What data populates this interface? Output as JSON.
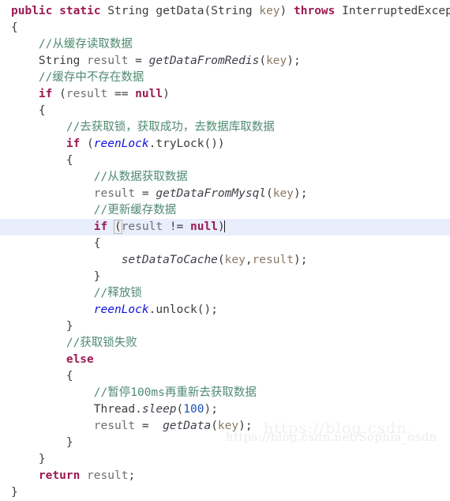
{
  "editor": {
    "language": "java",
    "background_color": "#ffffff",
    "current_line_highlight_color": "#e8eefc",
    "current_line_index": 12,
    "colors": {
      "keyword": "#9b1b52",
      "comment": "#4f8a72",
      "field": "#1010dd",
      "method": "#3f3f4a",
      "parameter": "#8a7a63",
      "number": "#1550b5",
      "text": "#3c3c3c"
    },
    "lines": [
      {
        "indent": 0,
        "tokens": [
          {
            "t": "public",
            "c": "kw"
          },
          {
            "t": " ",
            "c": "plain"
          },
          {
            "t": "static",
            "c": "kw"
          },
          {
            "t": " ",
            "c": "plain"
          },
          {
            "t": "String",
            "c": "type"
          },
          {
            "t": " ",
            "c": "plain"
          },
          {
            "t": "getData",
            "c": "plain"
          },
          {
            "t": "(",
            "c": "punct"
          },
          {
            "t": "String",
            "c": "type"
          },
          {
            "t": " ",
            "c": "plain"
          },
          {
            "t": "key",
            "c": "ident"
          },
          {
            "t": ") ",
            "c": "punct"
          },
          {
            "t": "throws",
            "c": "kw"
          },
          {
            "t": " ",
            "c": "plain"
          },
          {
            "t": "InterruptedException",
            "c": "type"
          }
        ]
      },
      {
        "indent": 0,
        "tokens": [
          {
            "t": "{",
            "c": "punct"
          }
        ]
      },
      {
        "indent": 1,
        "tokens": [
          {
            "t": "//从缓存读取数据",
            "c": "comment"
          }
        ]
      },
      {
        "indent": 1,
        "tokens": [
          {
            "t": "String",
            "c": "type"
          },
          {
            "t": " ",
            "c": "plain"
          },
          {
            "t": "result",
            "c": "local"
          },
          {
            "t": " = ",
            "c": "punct"
          },
          {
            "t": "getDataFromRedis",
            "c": "method"
          },
          {
            "t": "(",
            "c": "punct"
          },
          {
            "t": "key",
            "c": "ident"
          },
          {
            "t": ");",
            "c": "punct"
          }
        ]
      },
      {
        "indent": 1,
        "tokens": [
          {
            "t": "//缓存中不存在数据",
            "c": "comment"
          }
        ]
      },
      {
        "indent": 1,
        "tokens": [
          {
            "t": "if",
            "c": "kw"
          },
          {
            "t": " (",
            "c": "punct"
          },
          {
            "t": "result",
            "c": "local"
          },
          {
            "t": " == ",
            "c": "punct"
          },
          {
            "t": "null",
            "c": "kw"
          },
          {
            "t": ")",
            "c": "punct"
          }
        ]
      },
      {
        "indent": 1,
        "tokens": [
          {
            "t": "{",
            "c": "punct"
          }
        ]
      },
      {
        "indent": 2,
        "tokens": [
          {
            "t": "//去获取锁，获取成功，去数据库取数据",
            "c": "comment"
          }
        ]
      },
      {
        "indent": 2,
        "tokens": [
          {
            "t": "if",
            "c": "kw"
          },
          {
            "t": " (",
            "c": "punct"
          },
          {
            "t": "reenLock",
            "c": "field"
          },
          {
            "t": ".",
            "c": "punct"
          },
          {
            "t": "tryLock",
            "c": "plain"
          },
          {
            "t": "())",
            "c": "punct"
          }
        ]
      },
      {
        "indent": 2,
        "tokens": [
          {
            "t": "{",
            "c": "punct"
          }
        ]
      },
      {
        "indent": 3,
        "tokens": [
          {
            "t": "//从数据获取数据",
            "c": "comment"
          }
        ]
      },
      {
        "indent": 3,
        "tokens": [
          {
            "t": "result",
            "c": "local"
          },
          {
            "t": " = ",
            "c": "punct"
          },
          {
            "t": "getDataFromMysql",
            "c": "method"
          },
          {
            "t": "(",
            "c": "punct"
          },
          {
            "t": "key",
            "c": "ident"
          },
          {
            "t": ");",
            "c": "punct"
          }
        ]
      },
      {
        "indent": 3,
        "tokens": [
          {
            "t": "//更新缓存数据",
            "c": "comment"
          }
        ]
      },
      {
        "indent": 3,
        "current": true,
        "tokens": [
          {
            "t": "if",
            "c": "kw"
          },
          {
            "t": " ",
            "c": "plain"
          },
          {
            "t": "(",
            "c": "punct brace-match"
          },
          {
            "t": "result",
            "c": "local"
          },
          {
            "t": " != ",
            "c": "punct"
          },
          {
            "t": "null",
            "c": "kw"
          },
          {
            "t": ")",
            "c": "punct"
          },
          {
            "t": "",
            "c": "caret"
          }
        ]
      },
      {
        "indent": 3,
        "tokens": [
          {
            "t": "{",
            "c": "punct"
          }
        ]
      },
      {
        "indent": 4,
        "tokens": [
          {
            "t": "setDataToCache",
            "c": "method"
          },
          {
            "t": "(",
            "c": "punct"
          },
          {
            "t": "key",
            "c": "ident"
          },
          {
            "t": ",",
            "c": "punct"
          },
          {
            "t": "result",
            "c": "ident"
          },
          {
            "t": ");",
            "c": "punct"
          }
        ]
      },
      {
        "indent": 3,
        "tokens": [
          {
            "t": "}",
            "c": "punct"
          }
        ]
      },
      {
        "indent": 3,
        "tokens": [
          {
            "t": "//释放锁",
            "c": "comment"
          }
        ]
      },
      {
        "indent": 3,
        "tokens": [
          {
            "t": "reenLock",
            "c": "field"
          },
          {
            "t": ".",
            "c": "punct"
          },
          {
            "t": "unlock",
            "c": "plain"
          },
          {
            "t": "();",
            "c": "punct"
          }
        ]
      },
      {
        "indent": 2,
        "tokens": [
          {
            "t": "}",
            "c": "punct"
          }
        ]
      },
      {
        "indent": 2,
        "tokens": [
          {
            "t": "//获取锁失败",
            "c": "comment"
          }
        ]
      },
      {
        "indent": 2,
        "tokens": [
          {
            "t": "else",
            "c": "kw"
          }
        ]
      },
      {
        "indent": 2,
        "tokens": [
          {
            "t": "{",
            "c": "punct"
          }
        ]
      },
      {
        "indent": 3,
        "tokens": [
          {
            "t": "//暂停100ms再重新去获取数据",
            "c": "comment"
          }
        ]
      },
      {
        "indent": 3,
        "tokens": [
          {
            "t": "Thread",
            "c": "type"
          },
          {
            "t": ".",
            "c": "punct"
          },
          {
            "t": "sleep",
            "c": "method"
          },
          {
            "t": "(",
            "c": "punct"
          },
          {
            "t": "100",
            "c": "num"
          },
          {
            "t": ");",
            "c": "punct"
          }
        ]
      },
      {
        "indent": 3,
        "tokens": [
          {
            "t": "result",
            "c": "local"
          },
          {
            "t": " =  ",
            "c": "punct"
          },
          {
            "t": "getData",
            "c": "method"
          },
          {
            "t": "(",
            "c": "punct"
          },
          {
            "t": "key",
            "c": "ident"
          },
          {
            "t": ");",
            "c": "punct"
          }
        ]
      },
      {
        "indent": 2,
        "tokens": [
          {
            "t": "}",
            "c": "punct"
          }
        ]
      },
      {
        "indent": 1,
        "tokens": [
          {
            "t": "}",
            "c": "punct"
          }
        ]
      },
      {
        "indent": 1,
        "tokens": [
          {
            "t": "return",
            "c": "kw"
          },
          {
            "t": " ",
            "c": "plain"
          },
          {
            "t": "result",
            "c": "local"
          },
          {
            "t": ";",
            "c": "punct"
          }
        ]
      },
      {
        "indent": 0,
        "tokens": [
          {
            "t": "}",
            "c": "punct"
          }
        ]
      }
    ]
  },
  "watermarks": {
    "primary": "https://blog.csdn.net/Sophia_osdn",
    "secondary": "https://blog.csdn."
  }
}
